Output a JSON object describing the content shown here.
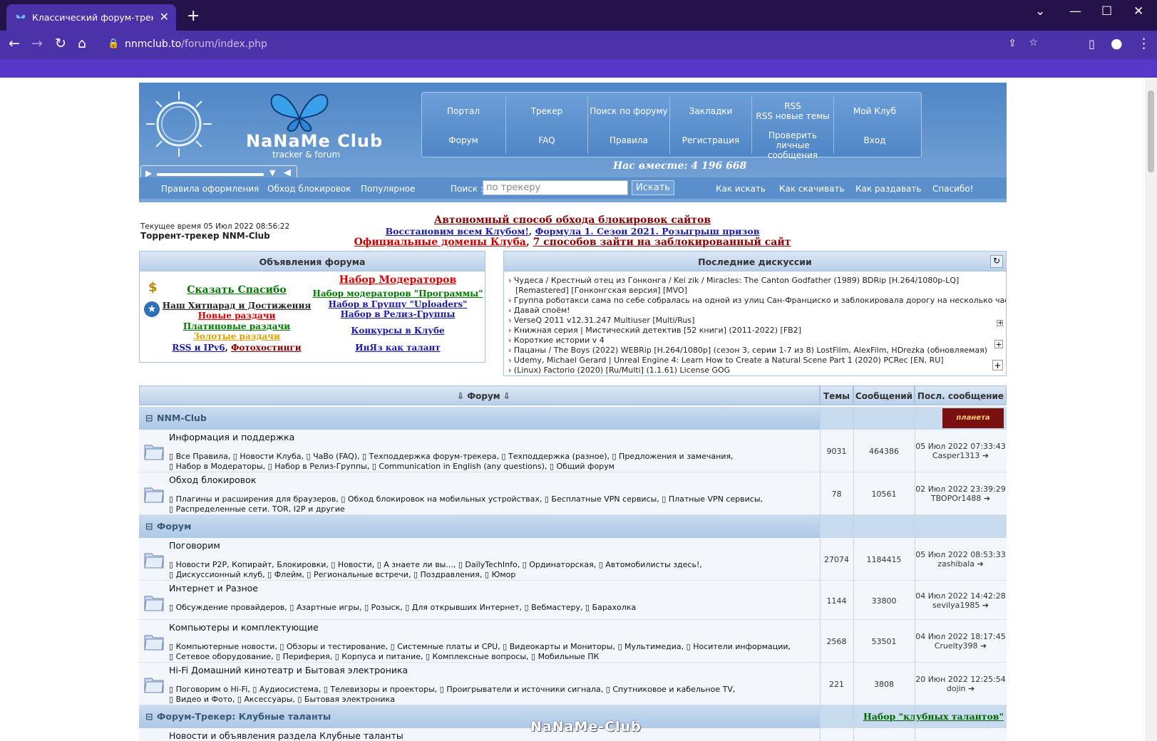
{
  "browser": {
    "tab_title": "Классический форум-трекер :: ",
    "url_host": "nnmclub.to",
    "url_path": "/forum/index.php"
  },
  "header": {
    "logo_text": "NaNaMe Club",
    "logo_sub": "tracker & forum",
    "together": "Нас вместе: 4 196 668",
    "menu_top": [
      "Портал",
      "Трекер",
      "Поиск по форуму",
      "Закладки",
      "RSS",
      "Мой Клуб"
    ],
    "rss_sub": "RSS новые темы",
    "menu_bottom": [
      "Форум",
      "FAQ",
      "Правила",
      "Регистрация",
      "Проверить личные",
      "Вход"
    ],
    "pm_sub": "сообщения"
  },
  "subnav": {
    "left": [
      "Правила оформления",
      "Обход блокировок",
      "Популярное"
    ],
    "search_label": "Поиск :",
    "search_placeholder": "по трекеру",
    "search_button": "Искать",
    "right": [
      "Как искать",
      "Как скачивать",
      "Как раздавать",
      "Спасибо!"
    ]
  },
  "status": {
    "current_time": "Текущее время 05 Июл 2022 08:56:22",
    "tracker_title": "Торрент-трекер NNM-Club"
  },
  "notices": {
    "line1": "Автономный способ обхода блокировок сайтов",
    "line2a": "Восстановим всем Клубом!",
    "line2b": "Формула 1. Сезон 2021. Розыгрыш призов",
    "line3a": "Официальные домены Клуба",
    "line3b": "7 способов зайти на заблокированный сайт"
  },
  "ads": {
    "title": "Объявления форума",
    "links": [
      "Сказать Спасибо",
      "Наш Хитпарад и Достижения",
      "Новые раздачи",
      "Платиновые раздачи",
      "Золотые раздачи",
      "RSS и IPv6",
      "Фотохостинги",
      "Набор Модераторов",
      "Набор модераторов \"Программы\"",
      "Набор в Группу \"Uploaders\"",
      "Набор в Релиз-Группы",
      "Конкурсы в Клубе",
      "ИнЯз как талант"
    ]
  },
  "discussions": {
    "title": "Последние дискуссии",
    "items": [
      "Чудеса / Крестный отец из Гонконга / Kei zik / Miracles: The Canton Godfather (1989) BDRip [H.264/1080p-LQ]",
      "[Remastered] [Гонконгская версия] [MVO]",
      "Группа роботакси сама по себе собралась на одной из улиц Сан-Франциско и заблокировала дорогу на несколько часов",
      "Давай споём!",
      "VerseQ 2011 v12.31.247 Multiuser [Multi/Rus]",
      "Книжная серия | Мистический детектив [52 книги] (2011-2022) [FB2]",
      "Короткие истории v 4",
      "Пацаны / The Boys (2022) WEBRip [H.264/1080p] (сезон 3, серии 1-7 из 8) LostFilm, AlexFilm, HDrezka (обновляемая)",
      "Udemy, Michael Gerard | Unreal Engine 4: Learn How to Create a Natural Scene Part 1 (2020) PCRec [EN, RU]",
      "(Linux) Factorio (2020) [Ru/Multi] (1.1.61) License GOG"
    ]
  },
  "forum": {
    "col_forum": "Форум",
    "col_topics": "Темы",
    "col_posts": "Сообщений",
    "col_last": "Посл. сообщение",
    "banner": "планета",
    "cat1": "NNM-Club",
    "cat2": "Форум",
    "cat3": "Форум-Трекер: Клубные таланты",
    "cat3_link": "Набор \"клубных талантов\"",
    "rows": [
      {
        "title": "Информация и поддержка",
        "subs1": "Все Правила, ▯ Новости Клуба, ▯ ЧаВо (FAQ), ▯ Техподдержка форум-трекера, ▯ Техподдержка (разное), ▯ Предложения и замечания,",
        "subs2": "Набор в Модераторы, ▯ Набор в Релиз-Группы, ▯ Communication in English (any questions), ▯ Общий форум",
        "topics": "9031",
        "posts": "464386",
        "date": "05 Июл 2022 07:33:43",
        "user": "Casper1313"
      },
      {
        "title": "Обход блокировок",
        "subs1": "Плагины и расширения для браузеров, ▯ Обход блокировок на мобильных устройствах, ▯ Бесплатные VPN сервисы, ▯ Платные VPN сервисы,",
        "subs2": "Распределенные сети. TOR, I2P и другие",
        "topics": "78",
        "posts": "10561",
        "date": "02 Июл 2022 23:39:29",
        "user": "TBOPOr1488"
      },
      {
        "title": "Поговорим",
        "subs1": "Новости P2P, Копирайт, Блокировки, ▯ Новости, ▯ А знаете ли вы..., ▯ DailyTechInfo, ▯ Ординаторская, ▯ Автомобилисты здесь!,",
        "subs2": "Дискуссионный клуб, ▯ Флейм, ▯ Региональные встречи, ▯ Поздравления, ▯ Юмор",
        "topics": "27074",
        "posts": "1184415",
        "date": "05 Июл 2022 08:53:33",
        "user": "zashibala"
      },
      {
        "title": "Интернет и Разное",
        "subs1": "Обсуждение провайдеров, ▯ Азартные игры, ▯ Розыск, ▯ Для открывших Интернет, ▯ Вебмастеру, ▯ Барахолка",
        "subs2": "",
        "topics": "1144",
        "posts": "33800",
        "date": "04 Июл 2022 14:42:28",
        "user": "sevilya1985"
      },
      {
        "title": "Компьютеры и комплектующие",
        "subs1": "Компьютерные новости, ▯ Обзоры и тестирование, ▯ Системные платы и CPU, ▯ Видеокарты и Мониторы, ▯ Мультимедиа, ▯ Носители информации,",
        "subs2": "Сетевое оборудование, ▯ Периферия, ▯ Корпуса и питание, ▯ Комплексные вопросы, ▯ Мобильные ПК",
        "topics": "2568",
        "posts": "53501",
        "date": "04 Июл 2022 18:17:45",
        "user": "Cruelty398"
      },
      {
        "title": "Hi-Fi Домашний кинотеатр и Бытовая электроника",
        "subs1": "Поговорим о Hi-Fi, ▯ Аудиосистема, ▯ Телевизоры и проекторы, ▯ Проигрыватели и источники сигнала, ▯ Спутниковое и кабельное TV,",
        "subs2": "Видео и Фото, ▯ Аксессуары, ▯ Бытовая электроника",
        "topics": "221",
        "posts": "3808",
        "date": "20 Июн 2022 12:25:54",
        "user": "dojin"
      }
    ],
    "partial_row": "Новости и объявления раздела Клубные таланты"
  },
  "footer_logo": "NaNaMe-Club"
}
